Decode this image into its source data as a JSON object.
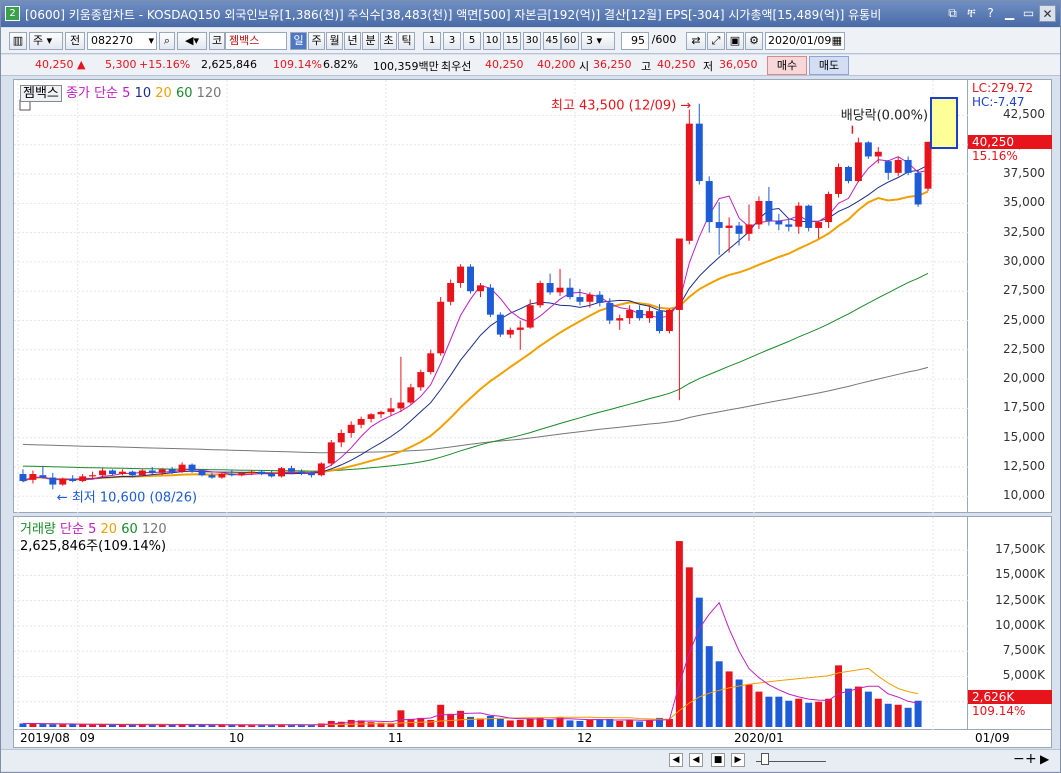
{
  "window": {
    "number": "2",
    "title": "[0600] 키움종합차트 - KOSDAQ150 외국인보유[1,386(천)] 주식수[38,483(천)] 액면[500] 자본금[192(억)] 결산[12월] EPS[-304] 시가총액[15,489(억)] 유통비"
  },
  "toolbar": {
    "period_main": "주",
    "period_prev": "전",
    "code": "082270",
    "market": "코",
    "stock_name": "젬백스",
    "periods": [
      "일",
      "주",
      "월",
      "년",
      "분",
      "초",
      "틱"
    ],
    "minutes": [
      "1",
      "3",
      "5",
      "10",
      "15",
      "30",
      "45",
      "60"
    ],
    "min_sel": "3",
    "count": "95",
    "total": "/600",
    "date": "2020/01/09"
  },
  "quote": {
    "price": "40,250",
    "arrow": "▲",
    "change": "5,300",
    "change_pct": "+15.16%",
    "volume": "2,625,846",
    "volume_pct": "109.14%",
    "turnover": "6.82%",
    "amount": "100,359백만",
    "best_label": "최우선",
    "ask": "40,250",
    "bid": "40,200",
    "open_label": "시",
    "open": "36,250",
    "high_label": "고",
    "high": "40,250",
    "low_label": "저",
    "low": "36,050",
    "buy": "매수",
    "sell": "매도"
  },
  "price_legend": {
    "name": "젬백스",
    "ma_label": "종가 단순",
    "ma": [
      "5",
      "10",
      "20",
      "60",
      "120"
    ]
  },
  "volume_legend": {
    "name": "거래량",
    "ma_label": "단순",
    "ma": [
      "5",
      "20",
      "60",
      "120"
    ],
    "last": "2,625,846주(109.14%)"
  },
  "annotations": {
    "high": "최고 43,500 (12/09)",
    "low": "최저 10,600 (08/26)",
    "dividend": "배당락(0.00%)"
  },
  "price_axis": {
    "ticks": [
      "42,500",
      "40,000",
      "37,500",
      "35,000",
      "32,500",
      "30,000",
      "27,500",
      "25,000",
      "22,500",
      "20,000",
      "17,500",
      "15,000",
      "12,500",
      "10,000"
    ],
    "lc": "LC:279.72",
    "hc": "HC:-7.47",
    "current": "40,250",
    "pct": "15.16%"
  },
  "volume_axis": {
    "ticks": [
      "17,500K",
      "15,000K",
      "12,500K",
      "10,000K",
      "7,500K",
      "5,000K"
    ],
    "current": "2,626K",
    "pct": "109.14%"
  },
  "date_axis": {
    "labels": [
      "2019/08",
      "09",
      "10",
      "11",
      "12",
      "2020/01",
      "01/09"
    ]
  },
  "colors": {
    "up": "#e8141c",
    "down": "#1e5bd6",
    "ma5": "#c020c0",
    "ma10": "#1b2e8a",
    "ma20": "#f0a000",
    "ma60": "#1a8a2a",
    "ma120": "#777777"
  },
  "chart_data": {
    "type": "candlestick",
    "title": "",
    "y_range": [
      9000,
      44500
    ],
    "candles": [
      {
        "o": 11900,
        "h": 12300,
        "l": 11200,
        "c": 11300
      },
      {
        "o": 11400,
        "h": 12200,
        "l": 11100,
        "c": 11900
      },
      {
        "o": 11800,
        "h": 12600,
        "l": 11500,
        "c": 11600
      },
      {
        "o": 11600,
        "h": 12000,
        "l": 10600,
        "c": 11000
      },
      {
        "o": 11000,
        "h": 11600,
        "l": 10900,
        "c": 11500
      },
      {
        "o": 11500,
        "h": 11800,
        "l": 11200,
        "c": 11300
      },
      {
        "o": 11300,
        "h": 11900,
        "l": 11200,
        "c": 11700
      },
      {
        "o": 11700,
        "h": 12100,
        "l": 11500,
        "c": 11800
      },
      {
        "o": 11800,
        "h": 12400,
        "l": 11600,
        "c": 12200
      },
      {
        "o": 12200,
        "h": 12300,
        "l": 11800,
        "c": 11900
      },
      {
        "o": 11900,
        "h": 12300,
        "l": 11800,
        "c": 12100
      },
      {
        "o": 12100,
        "h": 12200,
        "l": 11600,
        "c": 11800
      },
      {
        "o": 11800,
        "h": 12300,
        "l": 11700,
        "c": 12200
      },
      {
        "o": 12200,
        "h": 12500,
        "l": 11900,
        "c": 12000
      },
      {
        "o": 12000,
        "h": 12400,
        "l": 11800,
        "c": 12300
      },
      {
        "o": 12300,
        "h": 12500,
        "l": 11900,
        "c": 12100
      },
      {
        "o": 12100,
        "h": 12900,
        "l": 12000,
        "c": 12700
      },
      {
        "o": 12700,
        "h": 12800,
        "l": 12000,
        "c": 12200
      },
      {
        "o": 12200,
        "h": 12300,
        "l": 11700,
        "c": 11800
      },
      {
        "o": 11800,
        "h": 12000,
        "l": 11500,
        "c": 11600
      },
      {
        "o": 11600,
        "h": 12000,
        "l": 11500,
        "c": 11900
      },
      {
        "o": 11900,
        "h": 12200,
        "l": 11700,
        "c": 11800
      },
      {
        "o": 11800,
        "h": 12100,
        "l": 11700,
        "c": 12000
      },
      {
        "o": 12000,
        "h": 12200,
        "l": 11800,
        "c": 12100
      },
      {
        "o": 12100,
        "h": 12200,
        "l": 11800,
        "c": 11900
      },
      {
        "o": 11900,
        "h": 12200,
        "l": 11600,
        "c": 11700
      },
      {
        "o": 11700,
        "h": 12500,
        "l": 11600,
        "c": 12400
      },
      {
        "o": 12400,
        "h": 12600,
        "l": 12000,
        "c": 12100
      },
      {
        "o": 12100,
        "h": 12300,
        "l": 11800,
        "c": 12000
      },
      {
        "o": 12000,
        "h": 12100,
        "l": 11600,
        "c": 11800
      },
      {
        "o": 11800,
        "h": 12900,
        "l": 11700,
        "c": 12800
      },
      {
        "o": 12800,
        "h": 14800,
        "l": 12600,
        "c": 14600
      },
      {
        "o": 14600,
        "h": 15700,
        "l": 14200,
        "c": 15400
      },
      {
        "o": 15400,
        "h": 16400,
        "l": 15000,
        "c": 16100
      },
      {
        "o": 16100,
        "h": 16800,
        "l": 15800,
        "c": 16600
      },
      {
        "o": 16600,
        "h": 17100,
        "l": 16300,
        "c": 17000
      },
      {
        "o": 17000,
        "h": 17300,
        "l": 16700,
        "c": 17200
      },
      {
        "o": 17200,
        "h": 18400,
        "l": 16900,
        "c": 17500
      },
      {
        "o": 17500,
        "h": 21900,
        "l": 17200,
        "c": 18000
      },
      {
        "o": 18000,
        "h": 19600,
        "l": 17800,
        "c": 19300
      },
      {
        "o": 19300,
        "h": 20800,
        "l": 19000,
        "c": 20600
      },
      {
        "o": 20600,
        "h": 22500,
        "l": 20400,
        "c": 22200
      },
      {
        "o": 22200,
        "h": 27000,
        "l": 22000,
        "c": 26600
      },
      {
        "o": 26600,
        "h": 28500,
        "l": 26300,
        "c": 28200
      },
      {
        "o": 28200,
        "h": 29800,
        "l": 27800,
        "c": 29600
      },
      {
        "o": 29600,
        "h": 29800,
        "l": 27300,
        "c": 27500
      },
      {
        "o": 27500,
        "h": 28200,
        "l": 27000,
        "c": 28000
      },
      {
        "o": 27800,
        "h": 28100,
        "l": 25300,
        "c": 25500
      },
      {
        "o": 25500,
        "h": 25700,
        "l": 23600,
        "c": 23800
      },
      {
        "o": 23800,
        "h": 24400,
        "l": 23500,
        "c": 24200
      },
      {
        "o": 24200,
        "h": 25000,
        "l": 22500,
        "c": 24400
      },
      {
        "o": 24400,
        "h": 26800,
        "l": 24300,
        "c": 26300
      },
      {
        "o": 26300,
        "h": 28400,
        "l": 26100,
        "c": 28200
      },
      {
        "o": 28200,
        "h": 29000,
        "l": 27200,
        "c": 27400
      },
      {
        "o": 27400,
        "h": 29400,
        "l": 27100,
        "c": 27800
      },
      {
        "o": 27800,
        "h": 28600,
        "l": 26800,
        "c": 27000
      },
      {
        "o": 27000,
        "h": 27700,
        "l": 26300,
        "c": 26600
      },
      {
        "o": 26600,
        "h": 27400,
        "l": 26100,
        "c": 27200
      },
      {
        "o": 27200,
        "h": 27500,
        "l": 26200,
        "c": 26500
      },
      {
        "o": 26500,
        "h": 26900,
        "l": 24700,
        "c": 25000
      },
      {
        "o": 25000,
        "h": 25500,
        "l": 24200,
        "c": 25200
      },
      {
        "o": 25200,
        "h": 26300,
        "l": 24700,
        "c": 25900
      },
      {
        "o": 25900,
        "h": 26300,
        "l": 25000,
        "c": 25200
      },
      {
        "o": 25200,
        "h": 26300,
        "l": 24800,
        "c": 25800
      },
      {
        "o": 25800,
        "h": 26400,
        "l": 23900,
        "c": 24100
      },
      {
        "o": 24100,
        "h": 26000,
        "l": 23900,
        "c": 25900
      },
      {
        "o": 25900,
        "h": 26100,
        "l": 18200,
        "c": 32000
      },
      {
        "o": 31800,
        "h": 43000,
        "l": 31500,
        "c": 41800
      },
      {
        "o": 41800,
        "h": 43500,
        "l": 36600,
        "c": 36900
      },
      {
        "o": 36900,
        "h": 37300,
        "l": 32500,
        "c": 33400
      },
      {
        "o": 33400,
        "h": 35100,
        "l": 30600,
        "c": 32900
      },
      {
        "o": 32900,
        "h": 33800,
        "l": 30800,
        "c": 33100
      },
      {
        "o": 33100,
        "h": 33400,
        "l": 31400,
        "c": 32400
      },
      {
        "o": 32400,
        "h": 34900,
        "l": 31800,
        "c": 33200
      },
      {
        "o": 33200,
        "h": 35600,
        "l": 32800,
        "c": 35200
      },
      {
        "o": 35200,
        "h": 36400,
        "l": 33100,
        "c": 33500
      },
      {
        "o": 33500,
        "h": 34100,
        "l": 32700,
        "c": 33200
      },
      {
        "o": 33200,
        "h": 33700,
        "l": 32600,
        "c": 33000
      },
      {
        "o": 33000,
        "h": 35100,
        "l": 32400,
        "c": 34800
      },
      {
        "o": 34800,
        "h": 34900,
        "l": 32600,
        "c": 32900
      },
      {
        "o": 32900,
        "h": 33500,
        "l": 32000,
        "c": 33400
      },
      {
        "o": 33400,
        "h": 36000,
        "l": 32900,
        "c": 35800
      },
      {
        "o": 35800,
        "h": 38400,
        "l": 35500,
        "c": 38100
      },
      {
        "o": 38100,
        "h": 38200,
        "l": 36700,
        "c": 36900
      },
      {
        "o": 36900,
        "h": 40600,
        "l": 36800,
        "c": 40200
      },
      {
        "o": 40200,
        "h": 40300,
        "l": 38800,
        "c": 39000
      },
      {
        "o": 39000,
        "h": 39800,
        "l": 38400,
        "c": 39400
      },
      {
        "o": 38600,
        "h": 38700,
        "l": 37000,
        "c": 37600
      },
      {
        "o": 37600,
        "h": 39000,
        "l": 37300,
        "c": 38700
      },
      {
        "o": 38700,
        "h": 39000,
        "l": 37400,
        "c": 37600
      },
      {
        "o": 37600,
        "h": 37800,
        "l": 34700,
        "c": 34900
      },
      {
        "o": 36250,
        "h": 40250,
        "l": 36050,
        "c": 40250
      }
    ],
    "volume_k": [
      350,
      350,
      300,
      280,
      260,
      300,
      250,
      240,
      260,
      220,
      230,
      210,
      250,
      220,
      240,
      230,
      260,
      240,
      200,
      190,
      210,
      200,
      220,
      210,
      200,
      190,
      260,
      220,
      200,
      180,
      350,
      600,
      520,
      700,
      650,
      480,
      420,
      380,
      1650,
      800,
      900,
      700,
      2200,
      1300,
      1600,
      1000,
      850,
      1100,
      800,
      650,
      700,
      800,
      900,
      700,
      1000,
      650,
      600,
      700,
      750,
      800,
      600,
      650,
      550,
      700,
      900,
      800,
      18400,
      15800,
      12800,
      8000,
      6500,
      5500,
      4700,
      4200,
      3500,
      3000,
      3000,
      2600,
      2800,
      2400,
      2500,
      2800,
      6100,
      3800,
      4000,
      3500,
      2800,
      2300,
      2200,
      1900,
      2600
    ]
  }
}
